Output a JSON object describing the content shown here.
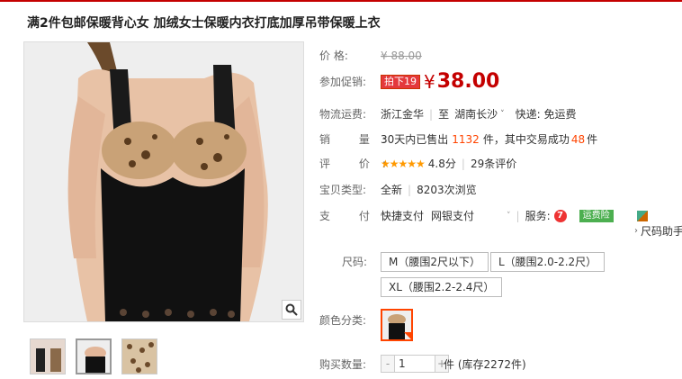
{
  "product": {
    "title": "满2件包邮保暖背心女 加绒女士保暖内衣打底加厚吊带保暖上衣"
  },
  "price": {
    "label": "价 格:",
    "original": "¥ 88.00",
    "promo_label": "参加促销:",
    "promo_tag": "拍下19",
    "symbol": "¥",
    "value": "38.00"
  },
  "shipping": {
    "label": "物流运费:",
    "from": "浙江金华",
    "to_word": "至",
    "to": "湖南长沙",
    "fee": "快递: 免运费"
  },
  "sales": {
    "label": "销 量:",
    "prefix": "30天内已售出",
    "count": "1132",
    "mid": "件，其中交易成功",
    "success": "48",
    "suffix": "件"
  },
  "rating": {
    "label": "评 价:",
    "stars": "★★★★★",
    "score": "4.8分",
    "reviews": "29条评价"
  },
  "item_type": {
    "label": "宝贝类型:",
    "value": "全新",
    "views": "8203次浏览"
  },
  "payment": {
    "label": "支 付:",
    "method1": "快捷支付",
    "method2": "网银支付",
    "service_label": "服务:",
    "badge": "运费险",
    "size_help": "尺码助手"
  },
  "size": {
    "label": "尺码:",
    "options": [
      "M（腰围2尺以下）",
      "L（腰围2.0-2.2尺）",
      "XL（腰围2.2-2.4尺）"
    ]
  },
  "color": {
    "label": "颜色分类:"
  },
  "quantity": {
    "label": "购买数量:",
    "minus": "-",
    "value": "1",
    "plus": "+",
    "stock": "件 (库存2272件)"
  },
  "colors": {
    "accent": "#c40000",
    "highlight": "#ff4400"
  }
}
